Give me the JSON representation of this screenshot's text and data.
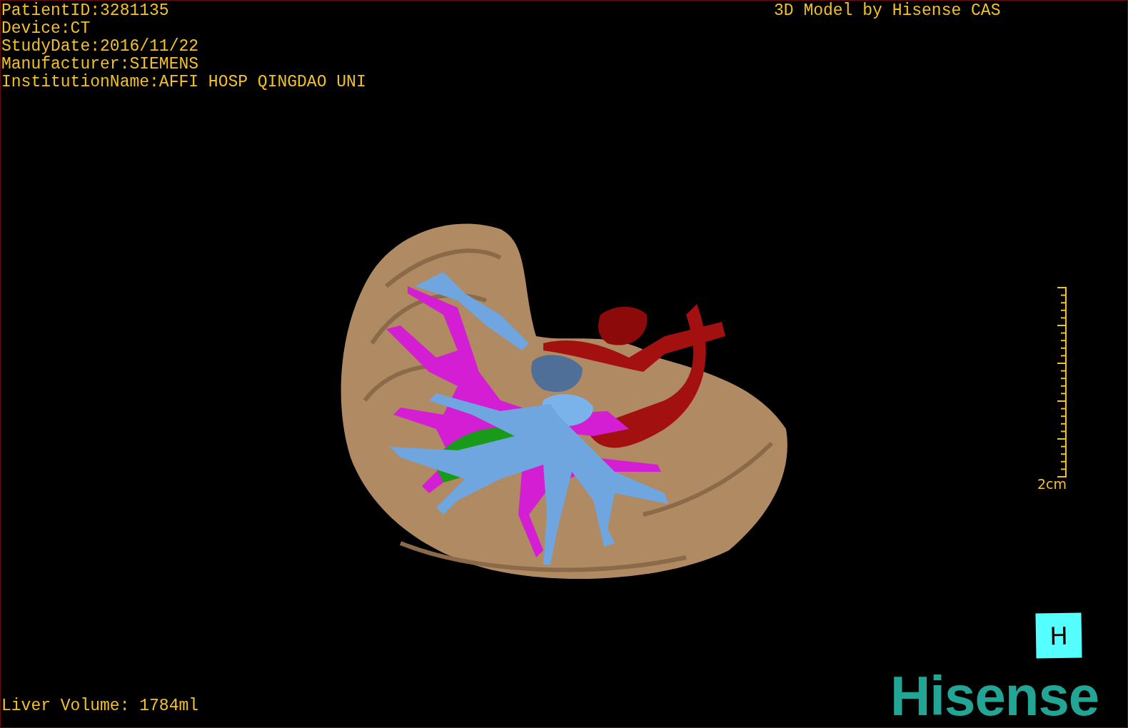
{
  "patient_info": [
    "PatientID:3281135",
    "Device:CT",
    "StudyDate:2016/11/22",
    "Manufacturer:SIEMENS",
    "InstitutionName:AFFI HOSP QINGDAO UNI"
  ],
  "title": "3D Model by Hisense CAS",
  "scale_bar": {
    "label": "2cm"
  },
  "orientation_marker": "H",
  "footer": "Liver Volume: 1784ml",
  "logo": "Hisense"
}
